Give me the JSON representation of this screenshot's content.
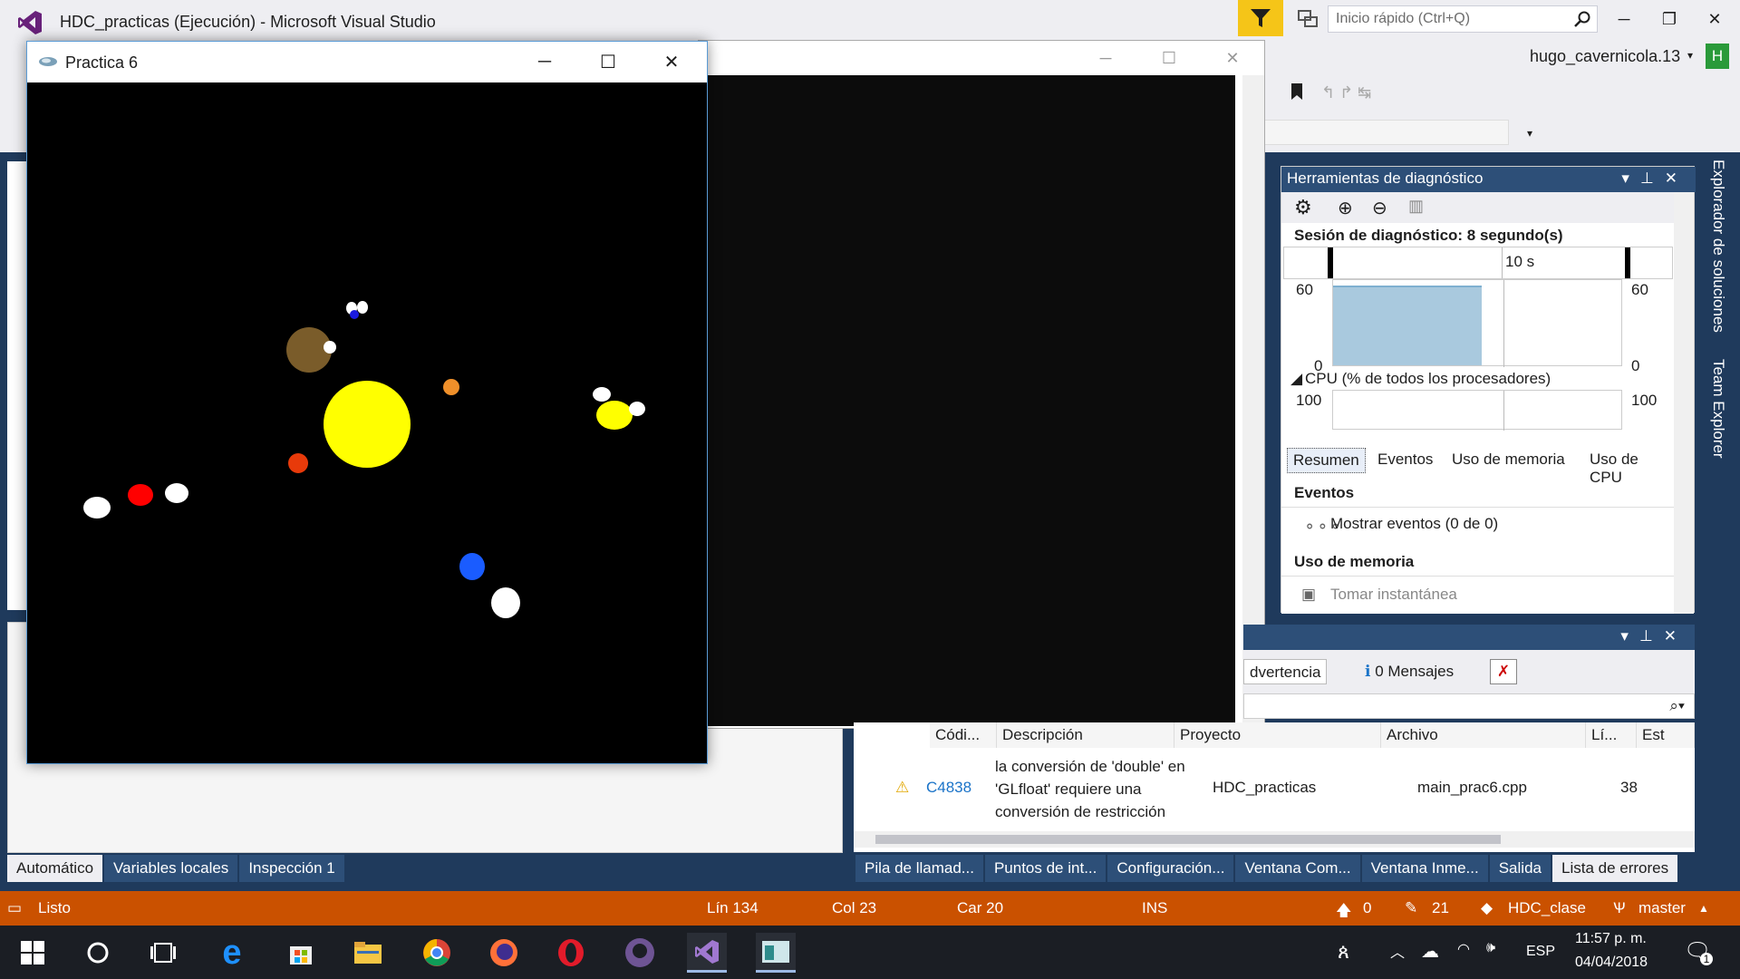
{
  "vs": {
    "title": "HDC_practicas (Ejecución) - Microsoft Visual Studio",
    "quick_launch_placeholder": "Inicio rápido (Ctrl+Q)",
    "user_name": "hugo_cavernicola.13",
    "user_initial": "H"
  },
  "gl_window": {
    "title": "Practica 6",
    "scene": {
      "background": "#000000",
      "bodies": [
        {
          "name": "sun",
          "color": "#ffff00"
        },
        {
          "name": "planet-orange",
          "color": "#f0902a"
        },
        {
          "name": "planet-red-orange",
          "color": "#e83a0a"
        },
        {
          "name": "planet-red",
          "color": "#ff0000"
        },
        {
          "name": "planet-blue",
          "color": "#1a5cff"
        },
        {
          "name": "planet-brown",
          "color": "#7a5c2a"
        },
        {
          "name": "planet-yellow",
          "color": "#ffff00"
        }
      ]
    }
  },
  "diag": {
    "header": "Herramientas de diagnóstico",
    "session": "Sesión de diagnóstico: 8 segundo(s)",
    "time_marker": "10 s",
    "mem_axis_top": "60",
    "mem_axis_bottom": "0",
    "cpu_title": "CPU (% de todos los procesadores)",
    "cpu_axis_top": "100",
    "tabs": [
      "Resumen",
      "Eventos",
      "Uso de memoria",
      "Uso de CPU"
    ],
    "events_heading": "Eventos",
    "show_events": "Mostrar eventos (0 de 0)",
    "memory_heading": "Uso de memoria",
    "snapshot": "Tomar instantánea"
  },
  "errors": {
    "filter_warning": "dvertencia",
    "filter_messages": "0 Mensajes",
    "columns": [
      "Códi...",
      "Descripción",
      "Proyecto",
      "Archivo",
      "Lí...",
      "Est"
    ],
    "rows": [
      {
        "code": "C4838",
        "description": "la conversión de 'double' en 'GLfloat' requiere una conversión de restricción",
        "project": "HDC_practicas",
        "file": "main_prac6.cpp",
        "line": "38"
      }
    ]
  },
  "bottom_tabs_left": [
    "Automático",
    "Variables locales",
    "Inspección 1"
  ],
  "bottom_tabs_right": [
    "Pila de llamad...",
    "Puntos de int...",
    "Configuración...",
    "Ventana Com...",
    "Ventana Inme...",
    "Salida",
    "Lista de errores"
  ],
  "right_vtabs": [
    "Explorador de soluciones",
    "Team Explorer"
  ],
  "status": {
    "state": "Listo",
    "line": "Lín 134",
    "col": "Col 23",
    "car": "Car 20",
    "mode": "INS",
    "up_count": "0",
    "pencil_count": "21",
    "repo": "HDC_clase",
    "branch": "master"
  },
  "taskbar": {
    "lang": "ESP",
    "time": "11:57 p. m.",
    "date": "04/04/2018",
    "notifications": "1"
  },
  "colors": {
    "accent_status": "#ca5100",
    "vs_panel_blue": "#2d4f78",
    "vs_purple": "#68217a"
  }
}
